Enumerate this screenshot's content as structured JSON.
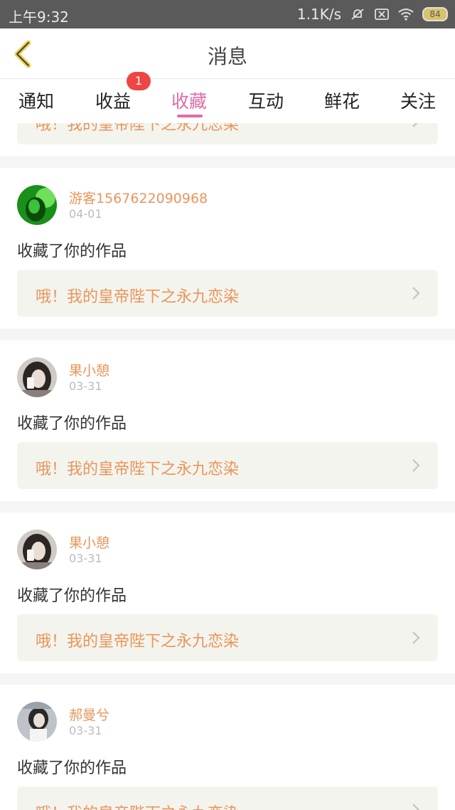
{
  "status_bar": {
    "time": "上午9:32",
    "net_speed": "1.1K/s",
    "battery": "84"
  },
  "header": {
    "title": "消息"
  },
  "tabs": [
    {
      "label": "通知"
    },
    {
      "label": "收益",
      "badge": "1"
    },
    {
      "label": "收藏",
      "active": true
    },
    {
      "label": "互动"
    },
    {
      "label": "鲜花"
    },
    {
      "label": "关注"
    }
  ],
  "colors": {
    "accent": "#e06ba8",
    "name": "#e8955b",
    "badge": "#f04545"
  },
  "partial_top": {
    "work_title": "哦！我的皇帝陛下之永九恋染"
  },
  "messages": [
    {
      "user": "游客1567622090968",
      "date": "04-01",
      "action": "收藏了你的作品",
      "work_title": "哦！我的皇帝陛下之永九恋染"
    },
    {
      "user": "果小憩",
      "date": "03-31",
      "action": "收藏了你的作品",
      "work_title": "哦！我的皇帝陛下之永九恋染"
    },
    {
      "user": "果小憩",
      "date": "03-31",
      "action": "收藏了你的作品",
      "work_title": "哦！我的皇帝陛下之永九恋染"
    },
    {
      "user": "郝曼兮",
      "date": "03-31",
      "action": "收藏了你的作品",
      "work_title": "哦！我的皇帝陛下之永九恋染"
    }
  ]
}
